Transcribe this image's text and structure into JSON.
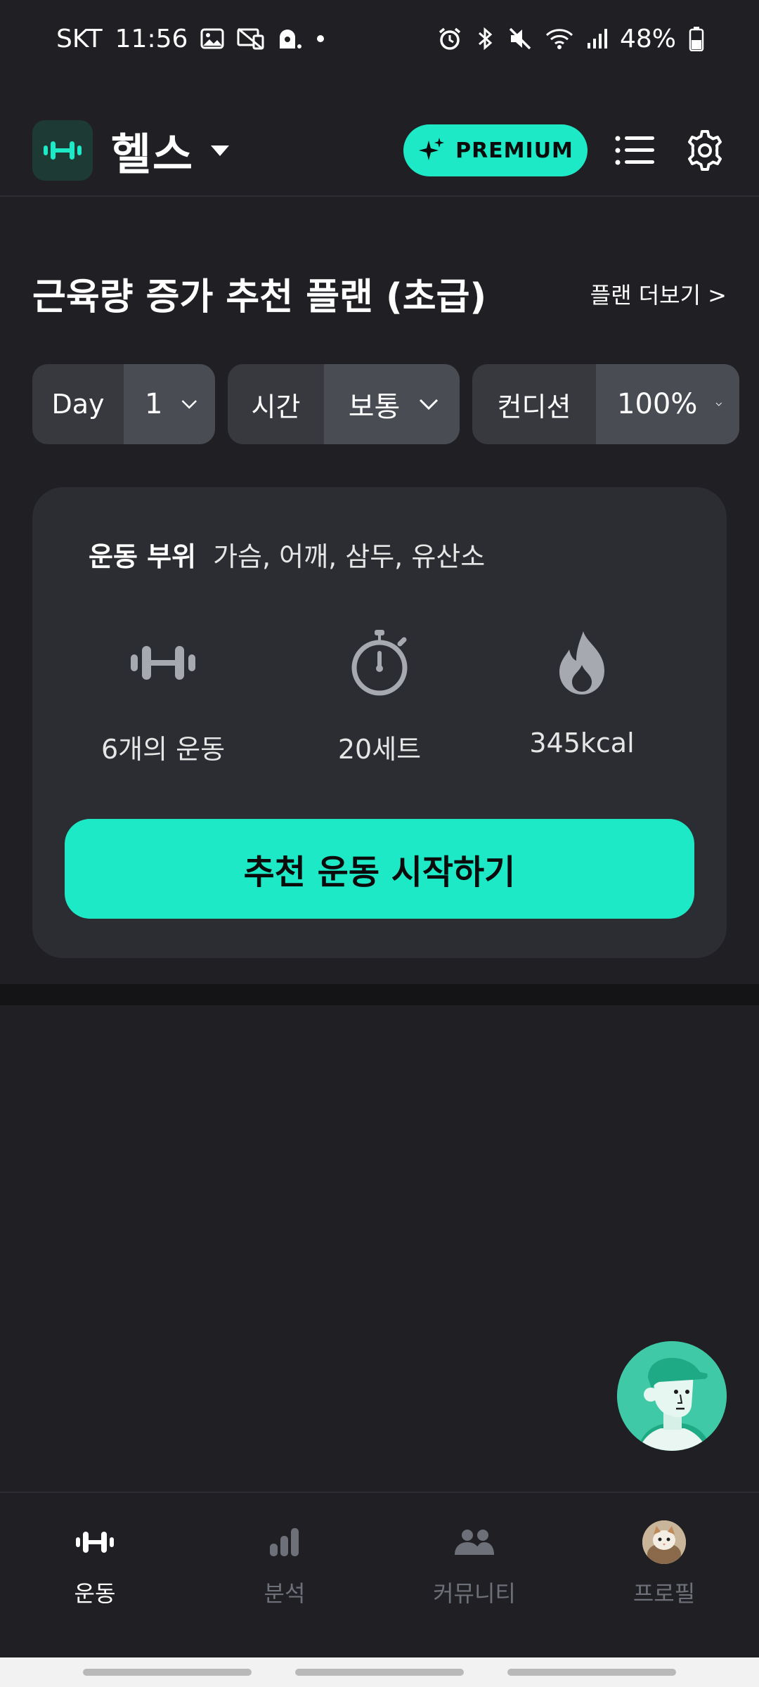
{
  "status_bar": {
    "carrier": "SKT",
    "time": "11:56",
    "battery": "48%"
  },
  "header": {
    "app_title": "헬스",
    "premium_label": "PREMIUM"
  },
  "plan": {
    "title": "근육량 증가 추천 플랜 (초급)",
    "more_label": "플랜 더보기 >"
  },
  "filters": [
    {
      "label": "Day",
      "value": "1"
    },
    {
      "label": "시간",
      "value": "보통"
    },
    {
      "label": "컨디션",
      "value": "100%"
    }
  ],
  "workout": {
    "body_parts_label": "운동 부위",
    "body_parts_value": "가슴, 어깨, 삼두, 유산소",
    "stats": [
      {
        "icon": "dumbbell-icon",
        "text": "6개의 운동"
      },
      {
        "icon": "stopwatch-icon",
        "text": "20세트"
      },
      {
        "icon": "flame-icon",
        "text": "345kcal"
      }
    ],
    "start_label": "추천 운동 시작하기"
  },
  "bottom_nav": [
    {
      "icon": "dumbbell-icon",
      "label": "운동",
      "active": true
    },
    {
      "icon": "bar-chart-icon",
      "label": "분석",
      "active": false
    },
    {
      "icon": "people-icon",
      "label": "커뮤니티",
      "active": false
    },
    {
      "icon": "profile-avatar",
      "label": "프로필",
      "active": false
    }
  ],
  "colors": {
    "accent": "#1de9c7",
    "background": "#202024",
    "card": "#2c2d33"
  }
}
